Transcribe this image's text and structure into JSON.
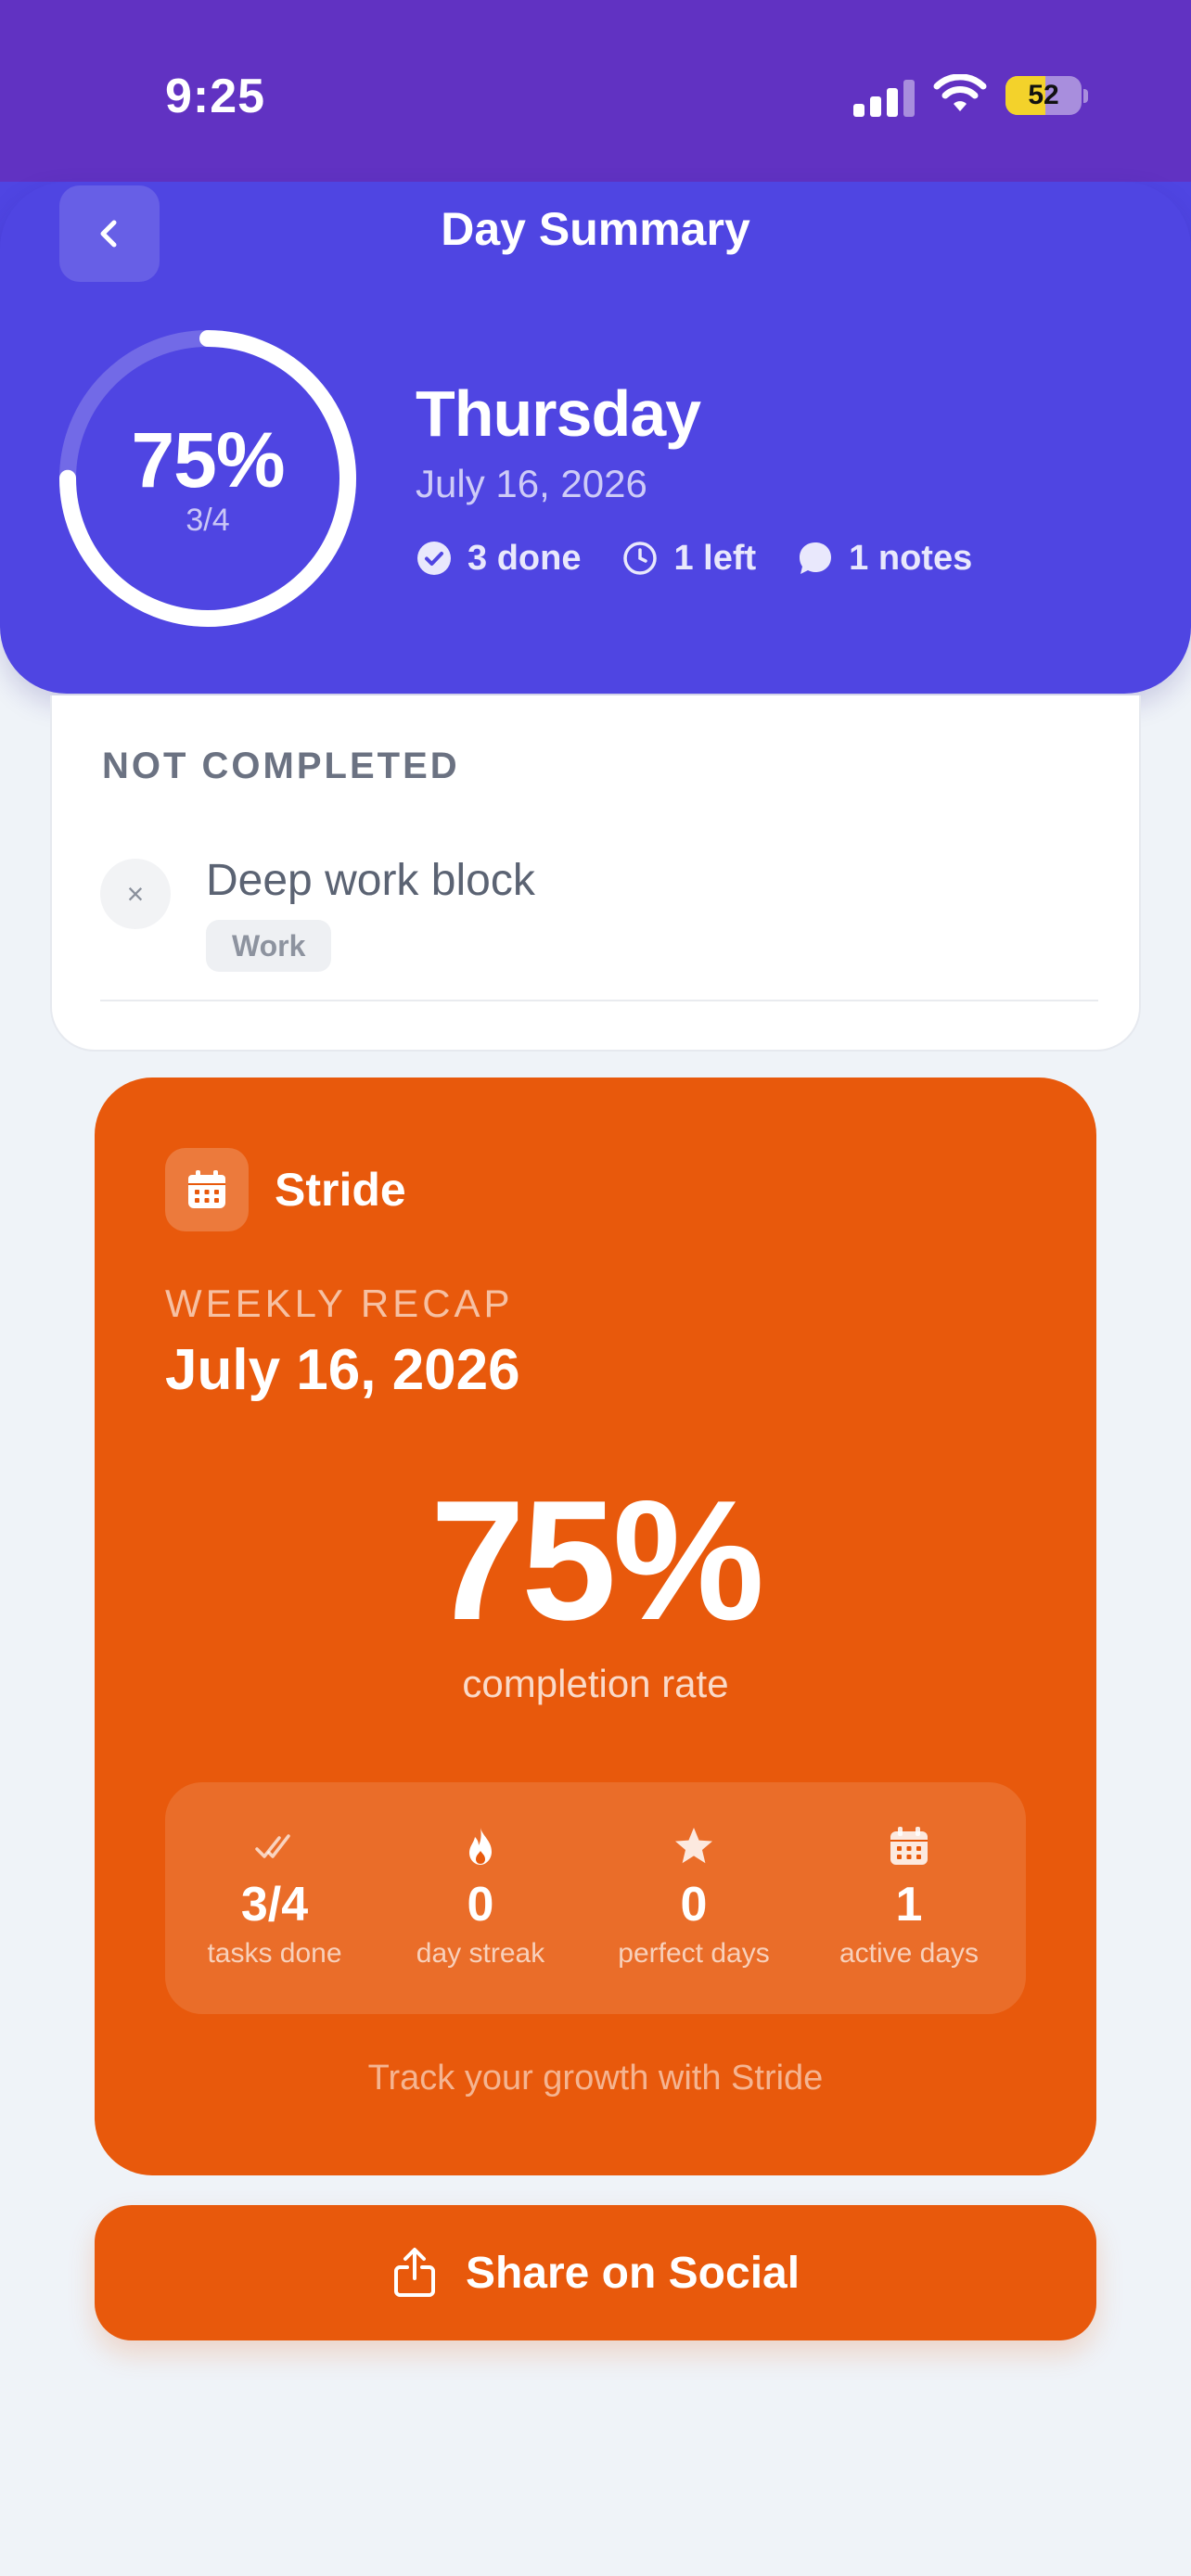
{
  "status_bar": {
    "time": "9:25",
    "battery_level": "52",
    "battery_fraction": 0.52
  },
  "header": {
    "title": "Day Summary"
  },
  "summary": {
    "progress_percent": "75%",
    "progress_fraction": "3/4",
    "progress_value": 0.75,
    "day": "Thursday",
    "date": "July 16, 2026",
    "stats": [
      {
        "icon": "check-circle-icon",
        "label": "3 done"
      },
      {
        "icon": "clock-icon",
        "label": "1 left"
      },
      {
        "icon": "chat-bubble-icon",
        "label": "1 notes"
      }
    ]
  },
  "not_completed": {
    "title": "NOT COMPLETED",
    "items": [
      {
        "task": "Deep work block",
        "tag": "Work",
        "status_glyph": "×"
      }
    ]
  },
  "recap": {
    "brand": "Stride",
    "label": "WEEKLY RECAP",
    "date": "July 16, 2026",
    "completion_rate": "75%",
    "completion_caption": "completion rate",
    "stats": [
      {
        "icon": "double-check-icon",
        "value": "3/4",
        "label": "tasks done"
      },
      {
        "icon": "flame-icon",
        "value": "0",
        "label": "day streak"
      },
      {
        "icon": "star-icon",
        "value": "0",
        "label": "perfect days"
      },
      {
        "icon": "calendar-icon",
        "value": "1",
        "label": "active days"
      }
    ],
    "footer": "Track your growth with Stride"
  },
  "share": {
    "label": "Share on Social",
    "icon": "share-icon"
  },
  "colors": {
    "status_bar": "#6132c2",
    "hero": "#4f45e2",
    "accent_orange": "#e8590c",
    "background": "#eff3f8"
  }
}
